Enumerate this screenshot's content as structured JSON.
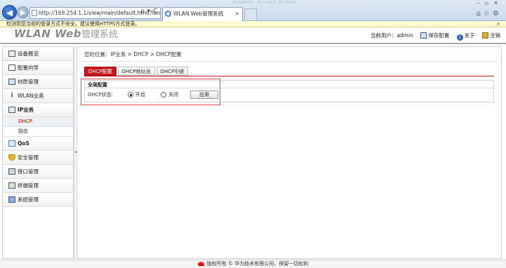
{
  "browser": {
    "url": "http://169.254.1.1/view/main/default.html?languag",
    "address_tools": "ρ ▾ C",
    "tab_title": "WLAN Web管理系统",
    "window_title": "WLANweb - Microsoft Windows",
    "security_message": "检测到您当前的登录方式不安全，建议使用HTTPS方式登录。",
    "security_close": "×"
  },
  "header": {
    "logo_wlan": "WLAN Web",
    "logo_cn": "管理系统",
    "current_user_label": "当前用户：admin",
    "save_config": "保存配置",
    "about": "关于",
    "logout": "注销"
  },
  "sidebar": {
    "items": [
      {
        "label": "设备概览",
        "icon": "device-icon"
      },
      {
        "label": "配置向导",
        "icon": "wizard-icon"
      },
      {
        "label": "材质管理",
        "icon": "material-icon"
      },
      {
        "label": "WLAN业务",
        "icon": "wifi-icon"
      },
      {
        "label": "IP业务",
        "icon": "ip-icon",
        "sub": [
          {
            "label": "DHCP",
            "active": true
          },
          {
            "label": "路由"
          }
        ]
      },
      {
        "label": "QoS",
        "icon": "qos-icon"
      },
      {
        "label": "安全管理",
        "icon": "shield-icon"
      },
      {
        "label": "接口管理",
        "icon": "interface-icon"
      },
      {
        "label": "终端管理",
        "icon": "terminal-icon"
      },
      {
        "label": "系统管理",
        "icon": "system-icon"
      }
    ]
  },
  "main": {
    "breadcrumb": "您的位置：IP业务 > DHCP > DHCP配置",
    "tabs": [
      {
        "label": "DHCP配置",
        "active": true
      },
      {
        "label": "DHCP地址池"
      },
      {
        "label": "DHCP中继"
      }
    ],
    "panel": {
      "title": "全局配置",
      "dhcp_status_label": "DHCP状态:",
      "option_on": "开启",
      "option_off": "关闭",
      "selected": "开启",
      "apply_button": "应用"
    }
  },
  "footer": {
    "text": "版权所有 © 华为技术有限公司，保留一切权利"
  },
  "colors": {
    "accent": "#c8171e",
    "highlight_border": "#e04848",
    "active_menu_text": "#c40000"
  }
}
